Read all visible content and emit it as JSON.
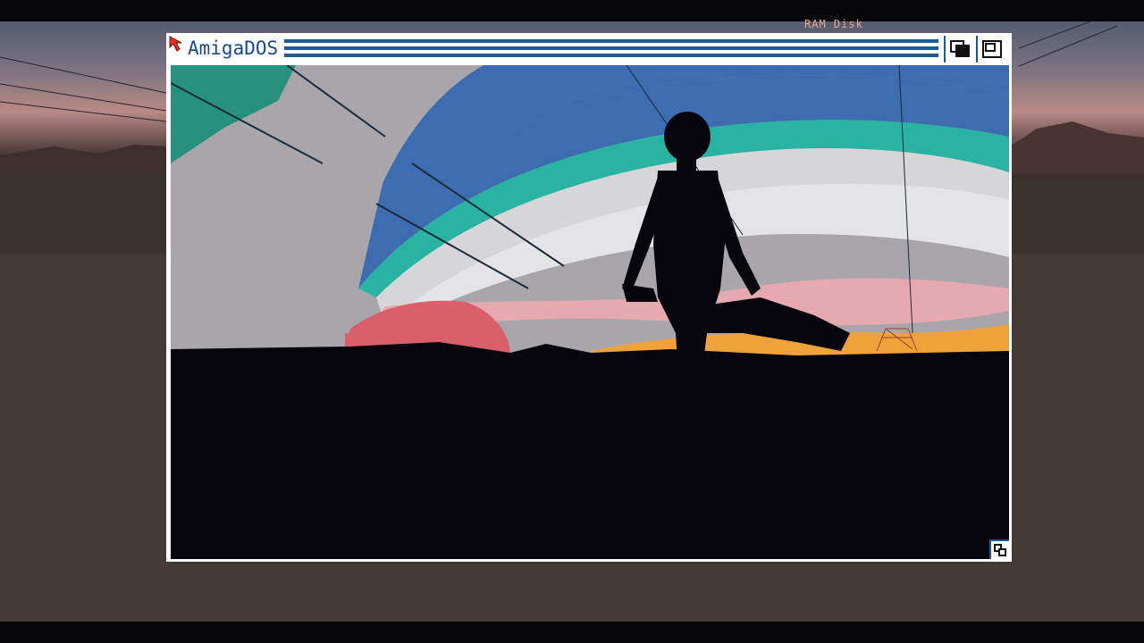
{
  "screen": {
    "title": "RAM Disk"
  },
  "window": {
    "title": "AmigaDOS",
    "gadgets": {
      "depth": "depth-gadget-icon",
      "zoom": "zoom-gadget-icon",
      "size": "size-gadget-icon"
    }
  },
  "colors": {
    "window_border": "#ffffff",
    "title_stripe": "#1a5a96",
    "title_text": "#1a4a8a",
    "pointer": "#e2332b"
  }
}
